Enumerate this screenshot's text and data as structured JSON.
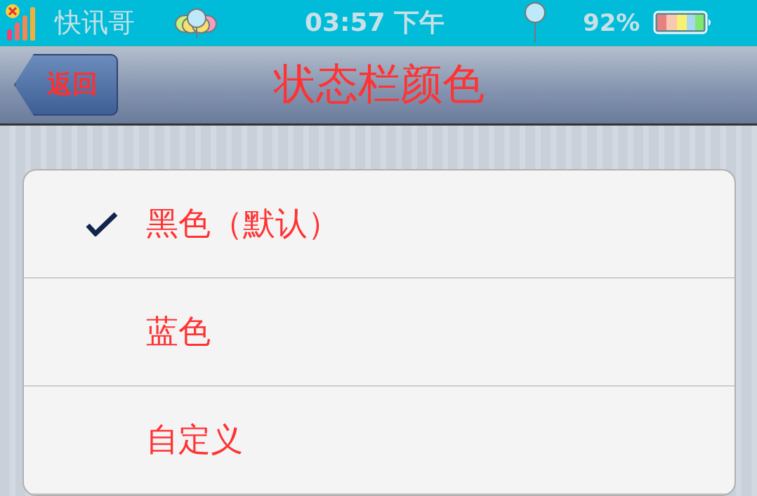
{
  "status_bar": {
    "carrier": "快讯哥",
    "time": "03:57 下午",
    "battery": "92%"
  },
  "nav_bar": {
    "back": "返回",
    "title": "状态栏颜色"
  },
  "options": [
    {
      "label": "黑色（默认）",
      "selected": true
    },
    {
      "label": "蓝色",
      "selected": false
    },
    {
      "label": "自定义",
      "selected": false
    }
  ]
}
